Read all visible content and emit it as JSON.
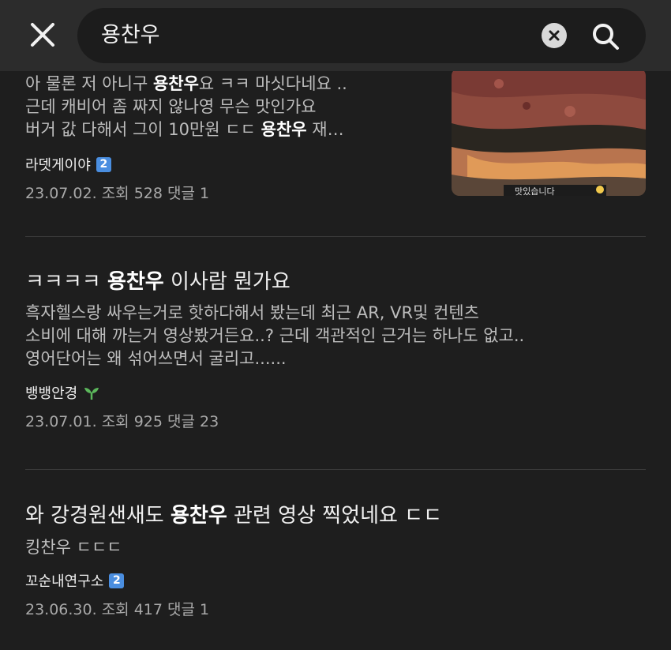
{
  "search": {
    "query": "용찬우"
  },
  "posts": [
    {
      "snippet_lines": [
        {
          "before": "아 물론 저 아니구 ",
          "bold": "용찬우",
          "after": "요 ㅋㅋ 마싯다네요 .."
        },
        {
          "before": "근데 캐비어 좀 짜지 않나영 무슨 맛인가요",
          "bold": "",
          "after": ""
        },
        {
          "before": "버거 값 다해서 그이 10만원 ㄷㄷ ",
          "bold": "용찬우",
          "after": " 재…"
        }
      ],
      "author": "라뎃게이야",
      "badge": "2",
      "date": "23.07.02.",
      "views_label": "조회",
      "views": "528",
      "comments_label": "댓글",
      "comments": "1",
      "thumbnail_caption": "맛있습니다"
    },
    {
      "title": {
        "before": "ㅋㅋㅋㅋ ",
        "bold": "용찬우",
        "after": " 이사람 뭔가요"
      },
      "snippet_lines": [
        "흑자헬스랑 싸우는거로 핫하다해서 봤는데 최근 AR, VR및 컨텐츠",
        "소비에 대해 까는거 영상봤거든요..? 근데 객관적인 근거는 하나도 없고..",
        "영어단어는 왜 섞어쓰면서 굴리고......"
      ],
      "author": "뱅뱅안경",
      "date": "23.07.01.",
      "views_label": "조회",
      "views": "925",
      "comments_label": "댓글",
      "comments": "23"
    },
    {
      "title": {
        "before": "와 강경원샌새도 ",
        "bold": "용찬우",
        "after": " 관련 영상 찍었네요 ㄷㄷ"
      },
      "snippet": "킹찬우 ㄷㄷㄷ",
      "author": "꼬순내연구소",
      "badge": "2",
      "date": "23.06.30.",
      "views_label": "조회",
      "views": "417",
      "comments_label": "댓글",
      "comments": "1"
    }
  ],
  "colors": {
    "background": "#1e1e1e",
    "topbar": "#2c2c2c",
    "badge": "#4a8ee0",
    "sprout": "#5cb85c"
  },
  "icons": [
    "close-icon",
    "clear-icon",
    "search-icon",
    "sprout-icon"
  ]
}
